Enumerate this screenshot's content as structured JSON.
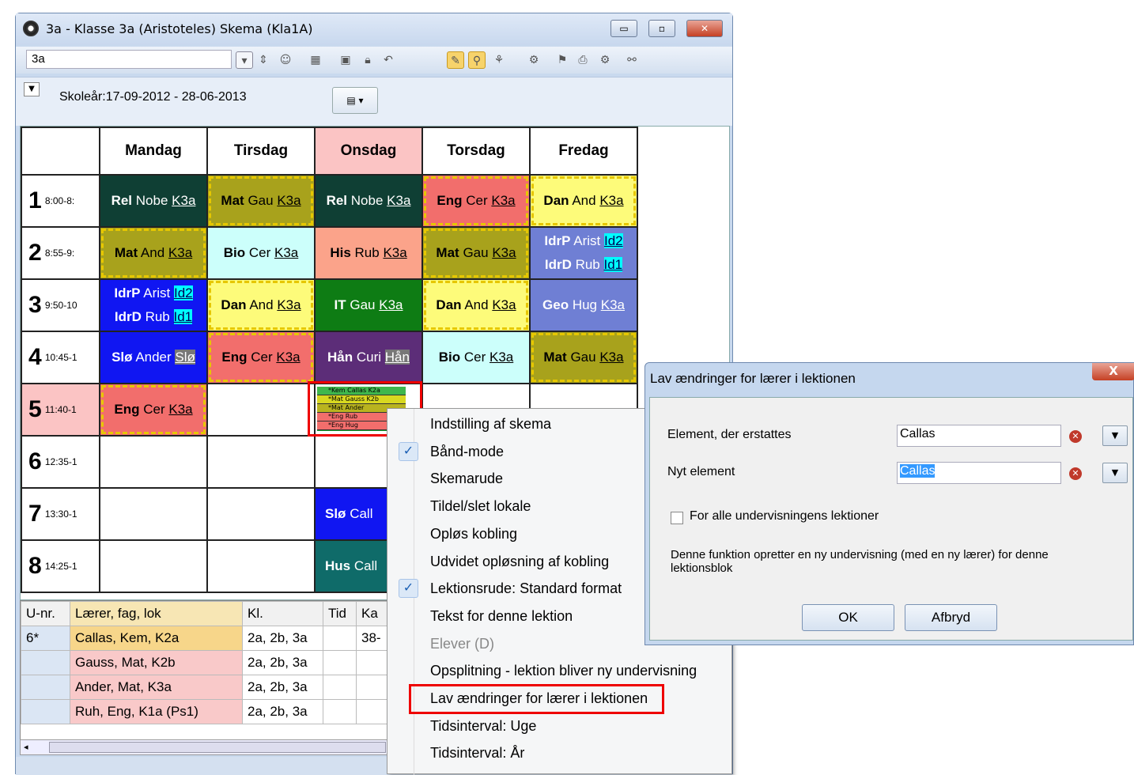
{
  "window": {
    "title": "3a - Klasse 3a (Aristoteles) Skema (Kla1A)",
    "class_value": "3a",
    "school_year": "Skoleår:17-09-2012 - 28-06-2013",
    "minimize": "▭",
    "maximize": "▫",
    "close": "✕"
  },
  "timetable": {
    "days": [
      "Mandag",
      "Tirsdag",
      "Onsdag",
      "Torsdag",
      "Fredag"
    ],
    "periods": [
      {
        "n": "1",
        "t": "8:00-8:"
      },
      {
        "n": "2",
        "t": "8:55-9:"
      },
      {
        "n": "3",
        "t": "9:50-10"
      },
      {
        "n": "4",
        "t": "10:45-1"
      },
      {
        "n": "5",
        "t": "11:40-1"
      },
      {
        "n": "6",
        "t": "12:35-1"
      },
      {
        "n": "7",
        "t": "13:30-1"
      },
      {
        "n": "8",
        "t": "14:25-1"
      }
    ],
    "cells": {
      "r1": [
        {
          "s": "Rel",
          "t": "Nobe",
          "r": "K3a"
        },
        {
          "s": "Mat",
          "t": "Gau",
          "r": "K3a"
        },
        {
          "s": "Rel",
          "t": "Nobe",
          "r": "K3a"
        },
        {
          "s": "Eng",
          "t": "Cer",
          "r": "K3a"
        },
        {
          "s": "Dan",
          "t": "And",
          "r": "K3a"
        }
      ],
      "r2": [
        {
          "s": "Mat",
          "t": "And",
          "r": "K3a"
        },
        {
          "s": "Bio",
          "t": "Cer",
          "r": "K3a"
        },
        {
          "s": "His",
          "t": "Rub",
          "r": "K3a"
        },
        {
          "s": "Mat",
          "t": "Gau",
          "r": "K3a"
        },
        {
          "s": "IdrP",
          "t": "Arist",
          "r": "Id2",
          "s2": "IdrD",
          "t2": "Rub",
          "r2": "Id1"
        }
      ],
      "r3": [
        {
          "s": "IdrP",
          "t": "Arist",
          "r": "Id2",
          "s2": "IdrD",
          "t2": "Rub",
          "r2": "Id1"
        },
        {
          "s": "Dan",
          "t": "And",
          "r": "K3a"
        },
        {
          "s": "IT",
          "t": "Gau",
          "r": "K3a"
        },
        {
          "s": "Dan",
          "t": "And",
          "r": "K3a"
        },
        {
          "s": "Geo",
          "t": "Hug",
          "r": "K3a"
        }
      ],
      "r4": [
        {
          "s": "Slø",
          "t": "Ander",
          "r": "Slø"
        },
        {
          "s": "Eng",
          "t": "Cer",
          "r": "K3a"
        },
        {
          "s": "Hån",
          "t": "Curi",
          "r": "Hån"
        },
        {
          "s": "Bio",
          "t": "Cer",
          "r": "K3a"
        },
        {
          "s": "Mat",
          "t": "Gau",
          "r": "K3a"
        }
      ],
      "r5": [
        {
          "s": "Eng",
          "t": "Cer",
          "r": "K3a"
        }
      ],
      "r7": {
        "s": "Slø",
        "t": "Call"
      },
      "r8": {
        "s": "Hus",
        "t": "Call"
      }
    },
    "mini_block": [
      "*Kem Callas K2a",
      "*Mat Gauss K2b",
      "*Mat Ander",
      "*Eng Rub",
      "*Eng Hug"
    ]
  },
  "lower_table": {
    "headers": [
      "U-nr.",
      "Lærer, fag, lok",
      "Kl.",
      "Tid",
      "Ka"
    ],
    "rows": [
      {
        "u": "6*",
        "l": "Callas, Kem, K2a",
        "k": "2a, 2b, 3a",
        "tid": "",
        "ka": "38-"
      },
      {
        "u": "",
        "l": "Gauss, Mat, K2b",
        "k": "2a, 2b, 3a",
        "tid": "",
        "ka": ""
      },
      {
        "u": "",
        "l": "Ander, Mat, K3a",
        "k": "2a, 2b, 3a",
        "tid": "",
        "ka": ""
      },
      {
        "u": "",
        "l": "Ruh, Eng, K1a (Ps1)",
        "k": "2a, 2b, 3a",
        "tid": "",
        "ka": ""
      }
    ]
  },
  "context_menu": {
    "items": [
      {
        "label": "Indstilling af skema",
        "checked": false,
        "disabled": false
      },
      {
        "label": "Bånd-mode",
        "checked": true,
        "disabled": false
      },
      {
        "label": "Skemarude",
        "checked": false,
        "disabled": false
      },
      {
        "label": "Tildel/slet lokale",
        "checked": false,
        "disabled": false
      },
      {
        "label": "Opløs kobling",
        "checked": false,
        "disabled": false
      },
      {
        "label": "Udvidet opløsning af kobling",
        "checked": false,
        "disabled": false
      },
      {
        "label": "Lektionsrude: Standard format",
        "checked": true,
        "disabled": false
      },
      {
        "label": "Tekst for denne lektion",
        "checked": false,
        "disabled": false
      },
      {
        "label": "Elever (D)",
        "checked": false,
        "disabled": true
      },
      {
        "label": "Opsplitning - lektion bliver ny undervisning",
        "checked": false,
        "disabled": false
      },
      {
        "label": "Lav ændringer for lærer i lektionen",
        "checked": false,
        "disabled": false
      },
      {
        "label": "Tidsinterval: Uge",
        "checked": false,
        "disabled": false
      },
      {
        "label": "Tidsinterval: År",
        "checked": false,
        "disabled": false
      }
    ],
    "check_glyph": "✓"
  },
  "dialog": {
    "title": "Lav ændringer for lærer i lektionen",
    "close": "X",
    "replace_label": "Element, der erstattes",
    "replace_value": "Callas",
    "new_label": "Nyt element",
    "new_value": "Callas",
    "checkbox_label": "For alle undervisningens lektioner",
    "checkbox_checked": false,
    "note": "Denne funktion opretter en ny undervisning (med en ny lærer) for denne lektionsblok",
    "ok": "OK",
    "cancel": "Afbryd"
  },
  "colors": {
    "darkgreen": "#0f3f34",
    "olive": "#a8a21c",
    "lightyellow": "#fdfb7a",
    "salmon": "#f26e6c",
    "lightcyan": "#ccfffb",
    "peach": "#fba38a",
    "green": "#0e7c14",
    "purple": "#5c2d78",
    "blue": "#1016f2",
    "lilac": "#6f7fd4",
    "teal": "#0f6b69",
    "pinkhead": "#fbc4c4"
  }
}
